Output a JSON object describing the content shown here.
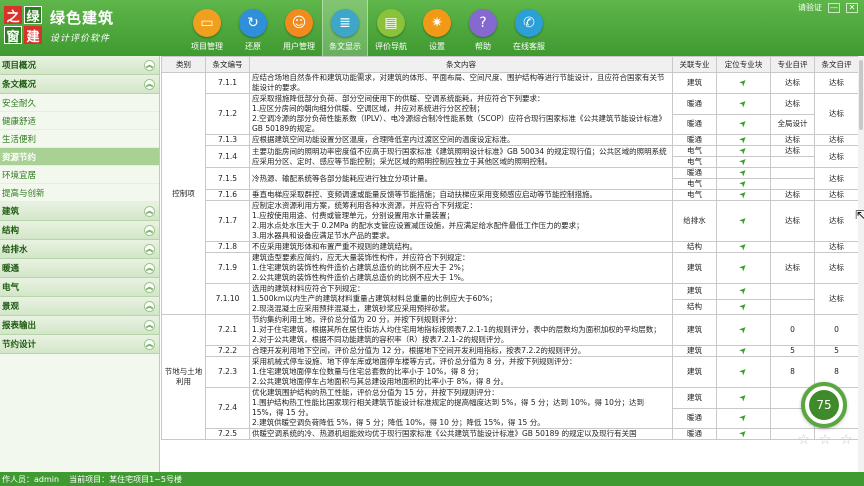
{
  "brand": {
    "logo_chars": [
      "之",
      "绿",
      "窗",
      "建"
    ],
    "title": "绿色建筑",
    "subtitle": "设计评价软件"
  },
  "header": {
    "user_label": "请验证",
    "min": "—",
    "close": "✕"
  },
  "nav": [
    {
      "label": "项目管理",
      "icon": "folder-icon",
      "color": "#f0a01e"
    },
    {
      "label": "还原",
      "icon": "restore-icon",
      "color": "#2f8fd8"
    },
    {
      "label": "用户管理",
      "icon": "user-icon",
      "color": "#f28b1e"
    },
    {
      "label": "条文显示",
      "icon": "document-icon",
      "color": "#3da6c9"
    },
    {
      "label": "评价导航",
      "icon": "notes-icon",
      "color": "#8ac23a"
    },
    {
      "label": "设置",
      "icon": "gear-icon",
      "color": "#f29a17"
    },
    {
      "label": "帮助",
      "icon": "help-icon",
      "color": "#8569d0"
    },
    {
      "label": "在线客服",
      "icon": "chat-icon",
      "color": "#2aa0d6"
    }
  ],
  "sidebar": {
    "items": [
      {
        "type": "section",
        "label": "项目概况"
      },
      {
        "type": "section",
        "label": "条文概况"
      },
      {
        "type": "sub",
        "label": "安全耐久"
      },
      {
        "type": "sub",
        "label": "健康舒适"
      },
      {
        "type": "sub",
        "label": "生活便利"
      },
      {
        "type": "sub",
        "label": "资源节约",
        "selected": true
      },
      {
        "type": "sub",
        "label": "环境宜居"
      },
      {
        "type": "sub",
        "label": "提高与创新"
      },
      {
        "type": "section",
        "label": "建筑"
      },
      {
        "type": "section",
        "label": "结构"
      },
      {
        "type": "section",
        "label": "给排水"
      },
      {
        "type": "section",
        "label": "暖通"
      },
      {
        "type": "section",
        "label": "电气"
      },
      {
        "type": "section",
        "label": "景观"
      },
      {
        "type": "section",
        "label": "报表输出"
      },
      {
        "type": "section",
        "label": "节约设计"
      }
    ]
  },
  "table": {
    "headers": [
      "类别",
      "条文编号",
      "条文内容",
      "关联专业",
      "定位专业块",
      "专业自评",
      "条文自评"
    ],
    "groups": [
      {
        "label": "控制项",
        "rows": [
          {
            "code": "7.1.1",
            "content": "应结合场地自然条件和建筑功能需求，对建筑的体形、平面布局、空间尺度、围护结构等进行节能设计，且应符合国家有关节能设计的要求。",
            "sub": [
              {
                "major": "建筑",
                "selfeval": "达标"
              }
            ],
            "clause": "达标"
          },
          {
            "code": "7.1.2",
            "content": "应采取措施降低部分负荷、部分空间使用下的供暖、空调系统能耗，并应符合下列要求：\n1.应区分房间的朝向细分供暖、空调区域，并应对系统进行分区控制；\n2.空调冷源的部分负荷性能系数（IPLV）、电冷源综合制冷性能系数（SCOP）应符合现行国家标准《公共建筑节能设计标准》GB 50189的规定。",
            "sub": [
              {
                "major": "暖通",
                "selfeval": "达标"
              },
              {
                "major": "暖通",
                "selfeval": "全局设计"
              }
            ],
            "clause": "达标"
          },
          {
            "code": "7.1.3",
            "content": "应根据建筑空间功能设置分区温度，合理降低室内过渡区空间的温度设定标准。",
            "sub": [
              {
                "major": "暖通",
                "selfeval": "达标"
              }
            ],
            "clause": "达标"
          },
          {
            "code": "7.1.4",
            "content": "主要功能房间的照明功率密度值不应高于现行国家标准《建筑照明设计标准》GB 50034 的规定现行值；公共区域的照明系统应采用分区、定时、感应等节能控制；采光区域的照明控制应独立于其他区域的照明控制。",
            "sub": [
              {
                "major": "电气",
                "selfeval": "达标"
              },
              {
                "major": "电气",
                "selfeval": ""
              }
            ],
            "clause": "达标"
          },
          {
            "code": "7.1.5",
            "content": "冷热源、输配系统等各部分能耗应进行独立分项计量。",
            "sub": [
              {
                "major": "暖通",
                "selfeval": ""
              },
              {
                "major": "电气",
                "selfeval": ""
              }
            ],
            "clause": "达标"
          },
          {
            "code": "7.1.6",
            "content": "垂直电梯应采取群控、变频调速或能量反馈等节能措施；自动扶梯应采用变频感应启动等节能控制措施。",
            "sub": [
              {
                "major": "电气",
                "selfeval": "达标"
              }
            ],
            "clause": "达标"
          },
          {
            "code": "7.1.7",
            "content": "应制定水资源利用方案，统筹利用各种水资源，并应符合下列规定：\n1.应按使用用途、付费或管理单元，分别设置用水计量装置；\n2.用水点处水压大于 0.2MPa 的配水支管应设置减压设施，并应满足给水配件最低工作压力的要求；\n3.用水器具和设备应满足节水产品的要求。",
            "sub": [
              {
                "major": "给排水",
                "selfeval": "达标"
              }
            ],
            "clause": "达标"
          },
          {
            "code": "7.1.8",
            "content": "不应采用建筑形体和布置严重不规则的建筑结构。",
            "sub": [
              {
                "major": "结构",
                "selfeval": ""
              }
            ],
            "clause": "达标"
          },
          {
            "code": "7.1.9",
            "content": "建筑造型要素应简约，应无大量装饰性构件，并应符合下列规定：\n1.住宅建筑的装饰性构件造价占建筑总造价的比例不应大于 2%；\n2.公共建筑的装饰性构件造价占建筑总造价的比例不应大于 1%。",
            "sub": [
              {
                "major": "建筑",
                "selfeval": "达标"
              }
            ],
            "clause": "达标"
          },
          {
            "code": "7.1.10",
            "content": "选用的建筑材料应符合下列规定：\n1.500km以内生产的建筑材料重量占建筑材料总重量的比例应大于60%；\n2.现浇混凝土应采用预拌混凝土，建筑砂浆应采用预拌砂浆。",
            "sub": [
              {
                "major": "建筑",
                "selfeval": ""
              },
              {
                "major": "结构",
                "selfeval": ""
              }
            ],
            "clause": "达标"
          }
        ]
      },
      {
        "label": "节地与土地利用",
        "rows": [
          {
            "code": "7.2.1",
            "content": "节约集约利用土地，评价总分值为 20 分，并按下列规则评分：\n1.对于住宅建筑，根据其所在居住街坊人均住宅用地指标按照表7.2.1-1的规则评分，表中的层数均为面积加权的平均层数；\n2.对于公共建筑，根据不同功能建筑的容积率（R）按表7.2.1-2的规则评分。",
            "sub": [
              {
                "major": "建筑",
                "selfeval": "0"
              }
            ],
            "clause": "0"
          },
          {
            "code": "7.2.2",
            "content": "合理开发利用地下空间，评价总分值为 12 分，根据地下空间开发利用指标，按表7.2.2的规则评分。",
            "sub": [
              {
                "major": "建筑",
                "selfeval": "5"
              }
            ],
            "clause": "5"
          },
          {
            "code": "7.2.3",
            "content": "采用机械式停车设施、地下停车库或地面停车楼等方式，评价总分值为 8 分，并按下列规则评分：\n1.住宅建筑地面停车位数量与住宅总套数的比率小于 10%，得 8 分；\n2.公共建筑地面停车占地面积与其总建设用地面积的比率小于 8%，得 8 分。",
            "sub": [
              {
                "major": "建筑",
                "selfeval": "8"
              }
            ],
            "clause": "8"
          },
          {
            "code": "7.2.4",
            "content": "优化建筑围护结构的热工性能，评价总分值为 15 分，并按下列规则评分：\n1.围护结构热工性能比国家现行相关建筑节能设计标准规定的提高幅度达到 5%，得 5 分；达到 10%，得 10分；达到 15%，得 15 分。\n2.建筑供暖空调负荷降低 5%，得 5 分；降低 10%，得 10 分；降低 15%，得 15 分。",
            "sub": [
              {
                "major": "建筑",
                "selfeval": ""
              },
              {
                "major": "暖通",
                "selfeval": ""
              }
            ],
            "clause": ""
          },
          {
            "code": "7.2.5",
            "content": "供暖空调系统的冷、热源机组能效均优于现行国家标准《公共建筑节能设计标准》GB 50189 的规定以及现行有关国",
            "sub": [
              {
                "major": "暖通",
                "selfeval": ""
              }
            ],
            "clause": ""
          }
        ]
      }
    ]
  },
  "score": {
    "value": "75",
    "stars": [
      "☆",
      "☆",
      "☆"
    ]
  },
  "status": {
    "author_label": "作人员：",
    "author": "admin",
    "project_label": "当前项目：",
    "project": "某住宅项目1~5号楼"
  }
}
